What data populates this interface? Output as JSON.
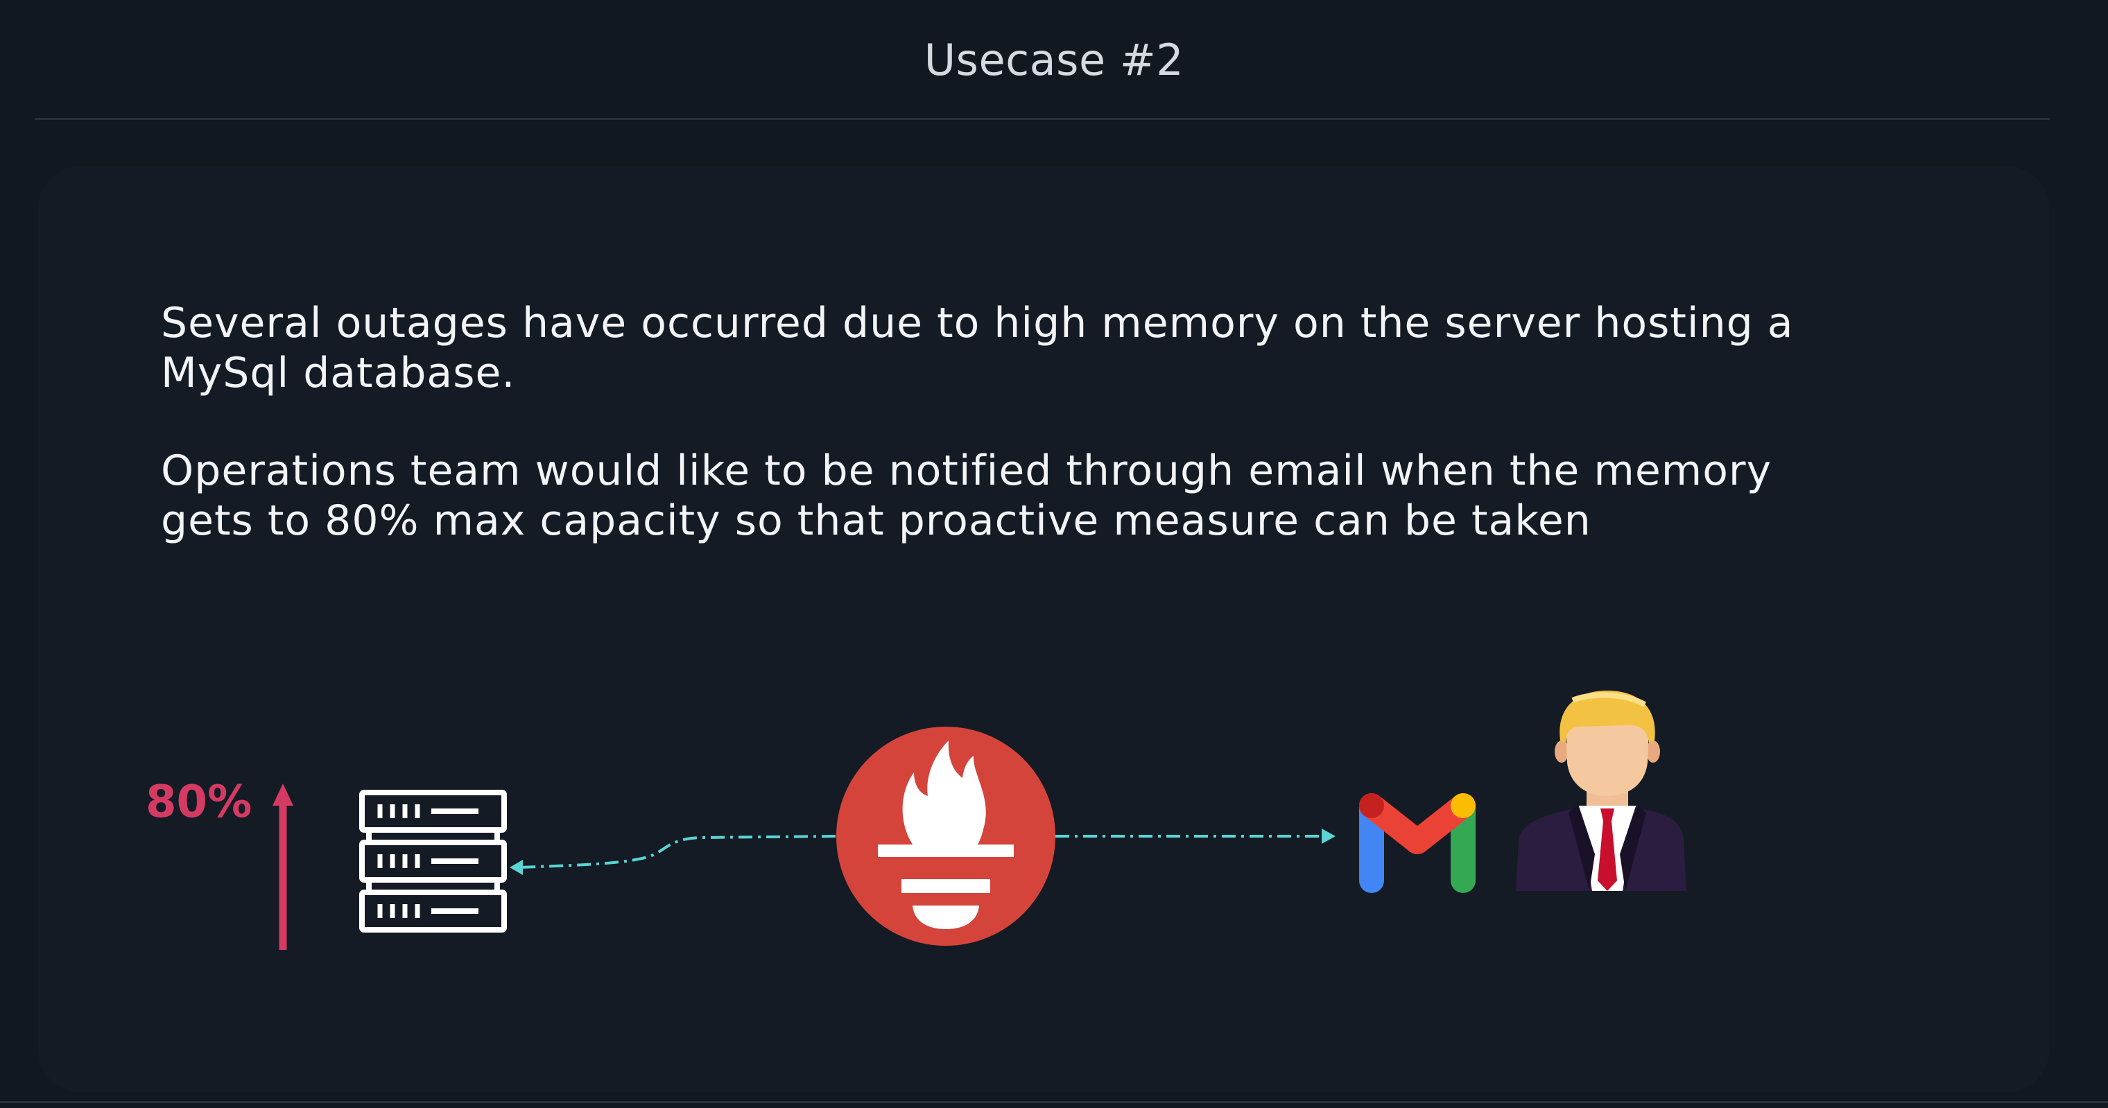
{
  "header": {
    "title": "Usecase #2"
  },
  "content": {
    "paragraph_1": "Several outages have occurred due to high memory on the server hosting a\nMySql database.",
    "paragraph_2": "Operations team would like to be notified through email when the memory\ngets to 80% max capacity so that proactive measure can be taken"
  },
  "diagram": {
    "memory_threshold_label": "80%",
    "colors": {
      "background": "#121820",
      "panel": "#141b24",
      "threshold": "#d53b62",
      "prometheus": "#d5443a",
      "connector": "#5ad4d4",
      "server": "#ffffff"
    },
    "icons": {
      "threshold_arrow": "arrow-up-icon",
      "server": "server-rack-icon",
      "prometheus": "prometheus-icon",
      "email": "gmail-icon",
      "recipient": "businessman-icon"
    }
  }
}
